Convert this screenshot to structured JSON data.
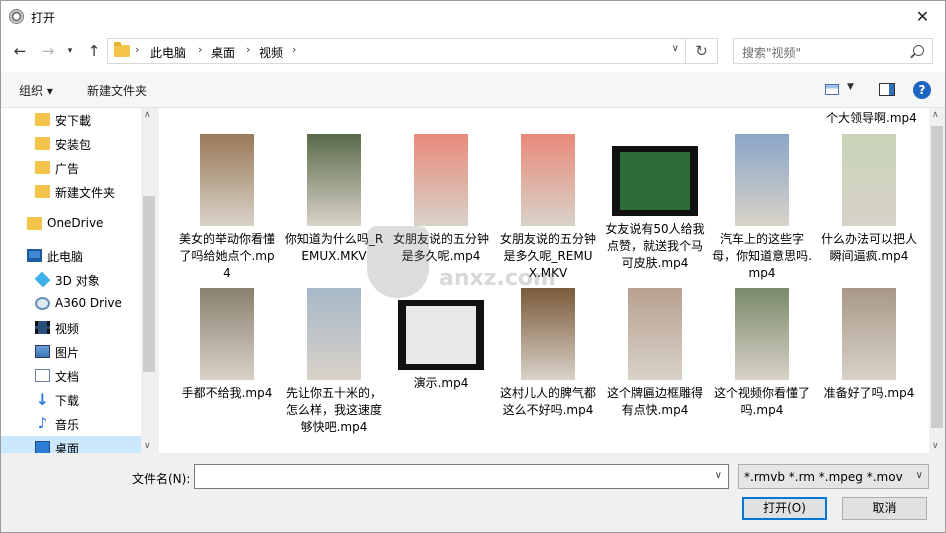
{
  "window": {
    "title": "打开"
  },
  "address": {
    "crumbs": [
      "此电脑",
      "桌面",
      "视频"
    ]
  },
  "search": {
    "placeholder": "搜索\"视频\""
  },
  "toolbar": {
    "organize": "组织 ▾",
    "new_folder": "新建文件夹"
  },
  "sidebar": {
    "items": [
      {
        "label": "安下載",
        "icon": "folder-icon"
      },
      {
        "label": "安装包",
        "icon": "folder-icon"
      },
      {
        "label": "广告",
        "icon": "folder-icon"
      },
      {
        "label": "新建文件夹",
        "icon": "folder-icon"
      },
      {
        "label": "OneDrive",
        "icon": "onedrive-folder-icon"
      },
      {
        "label": "此电脑",
        "icon": "computer-icon"
      },
      {
        "label": "3D 对象",
        "icon": "3d-objects-icon"
      },
      {
        "label": "A360 Drive",
        "icon": "drive-icon"
      },
      {
        "label": "视频",
        "icon": "video-folder-icon"
      },
      {
        "label": "图片",
        "icon": "pictures-icon"
      },
      {
        "label": "文档",
        "icon": "documents-icon"
      },
      {
        "label": "下载",
        "icon": "download-icon"
      },
      {
        "label": "音乐",
        "icon": "music-icon"
      },
      {
        "label": "桌面",
        "icon": "desktop-icon"
      }
    ]
  },
  "files": {
    "partial_top": "个大领导啊.mp4",
    "row1": [
      {
        "label": "美女的举动你看懂了吗给她点个.mp4",
        "color": "#9a7a5a"
      },
      {
        "label": "你知道为什么吗_REMUX.MKV",
        "color": "#5a6a4a"
      },
      {
        "label": "女朋友说的五分钟是多久呢.mp4",
        "color": "#e88a7a"
      },
      {
        "label": "女朋友说的五分钟是多久呢_REMUX.MKV",
        "color": "#e88a7a"
      },
      {
        "label": "女友说有50人给我点赞，就送我个马可皮肤.mp4",
        "color": "#2c6d3a"
      },
      {
        "label": "汽车上的这些字母，你知道意思吗.mp4",
        "color": "#8aa6c8"
      },
      {
        "label": "什么办法可以把人瞬间逼疯.mp4",
        "color": "#c8d4b8"
      }
    ],
    "row2": [
      {
        "label": "手都不给我.mp4",
        "color": "#8a8070"
      },
      {
        "label": "先让你五十米的，怎么样，我这速度够快吧.mp4",
        "color": "#a8b8c8"
      },
      {
        "label": "演示.mp4",
        "color": "#e8e8e8"
      },
      {
        "label": "这村儿人的脾气都这么不好吗.mp4",
        "color": "#7a5a3a"
      },
      {
        "label": "这个牌匾边框雕得有点快.mp4",
        "color": "#b8a090"
      },
      {
        "label": "这个视频你看懂了吗.mp4",
        "color": "#7a8a6a"
      },
      {
        "label": "准备好了吗.mp4",
        "color": "#a89888"
      }
    ]
  },
  "watermark": {
    "text": "anxz.com"
  },
  "bottom": {
    "filename_label": "文件名(N):",
    "filename_value": "",
    "filter": "*.rmvb *.rm *.mpeg *.mov *.a",
    "open": "打开(O)",
    "cancel": "取消"
  }
}
